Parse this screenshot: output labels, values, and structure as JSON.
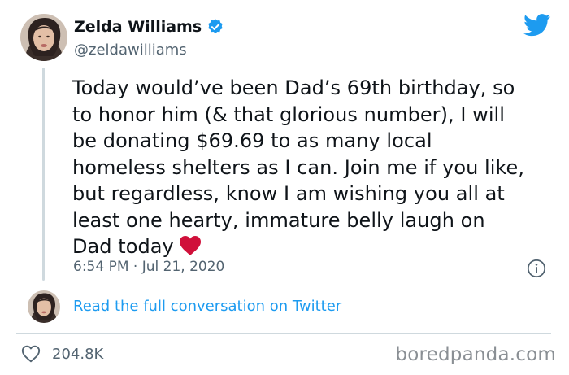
{
  "author": {
    "display_name": "Zelda Williams",
    "handle": "@zeldawilliams",
    "verified": true
  },
  "tweet": {
    "text_lines": [
      "Today would’ve been Dad’s 69th birthday, so",
      "to honor him (& that glorious number), I will",
      "be donating $69.69 to as many local",
      "homeless shelters as I can. Join me if you like,",
      "but regardless, know I am wishing you all at",
      "least one hearty, immature belly laugh on",
      "Dad today"
    ],
    "emoji": "red-heart",
    "timestamp": "6:54 PM · Jul 21, 2020"
  },
  "conversation": {
    "link_label": "Read the full conversation on Twitter"
  },
  "footer": {
    "like_count": "204.8K",
    "watermark": "boredpanda.com"
  },
  "colors": {
    "twitter_blue": "#1d9bf0",
    "heart_red": "#d0103a",
    "muted_text": "#536471",
    "divider": "#cfd9de"
  },
  "icons": {
    "brand": "twitter-bird-icon",
    "verified": "verified-badge-icon",
    "info": "info-icon",
    "like": "heart-outline-icon"
  }
}
